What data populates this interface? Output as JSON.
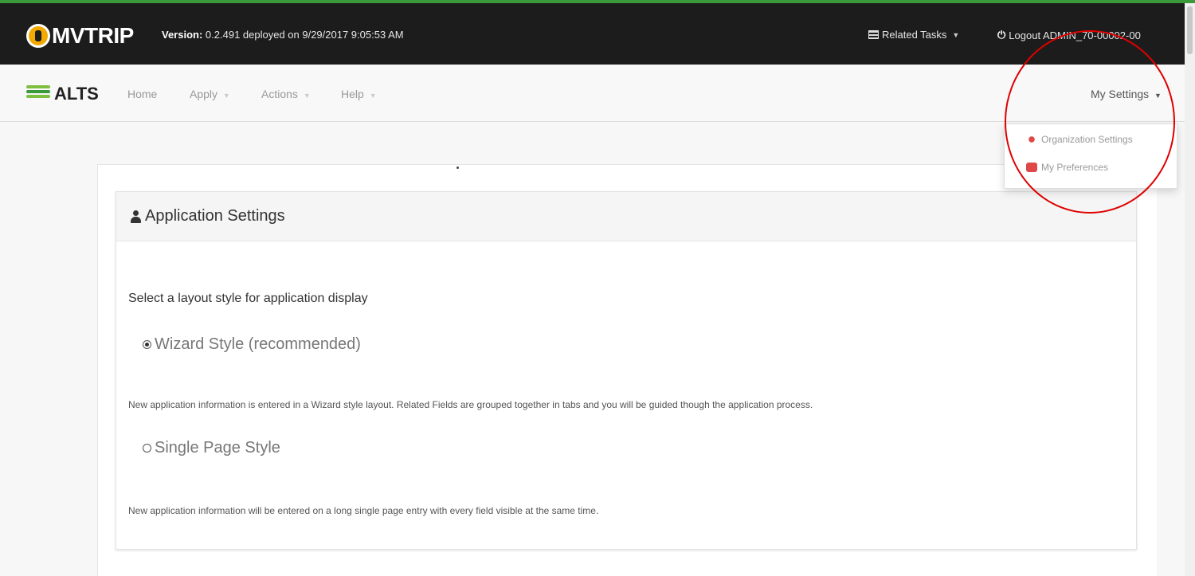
{
  "header": {
    "app_name": "MVTRIP",
    "version_label": "Version:",
    "version_text": "0.2.491 deployed on 9/29/2017 9:05:53 AM",
    "related_tasks": "Related Tasks",
    "logout": "Logout ADMIN_70-00002-00"
  },
  "nav": {
    "logo_text": "ALTS",
    "items": [
      "Home",
      "Apply",
      "Actions",
      "Help"
    ],
    "my_settings": "My Settings"
  },
  "dropdown": {
    "organization_settings": "Organization Settings",
    "my_preferences": "My Preferences"
  },
  "card": {
    "title": "Application Settings",
    "prompt": "Select a layout style for application display",
    "wizard_label": "Wizard Style (recommended)",
    "wizard_desc": "New application information is entered in a Wizard style layout. Related Fields are grouped together in tabs and you will be guided though the application process.",
    "single_label": "Single Page Style",
    "single_desc": "New application information will be entered on a long single page entry with every field visible at the same time.",
    "selected": "Wizard Style (recommended)"
  },
  "colors": {
    "top_bar": "#1c1c1c",
    "accent_green": "#3a9a3a",
    "logo_orange": "#f2a900",
    "highlight_circle": "#e00000",
    "dropdown_icon": "#e04848"
  }
}
